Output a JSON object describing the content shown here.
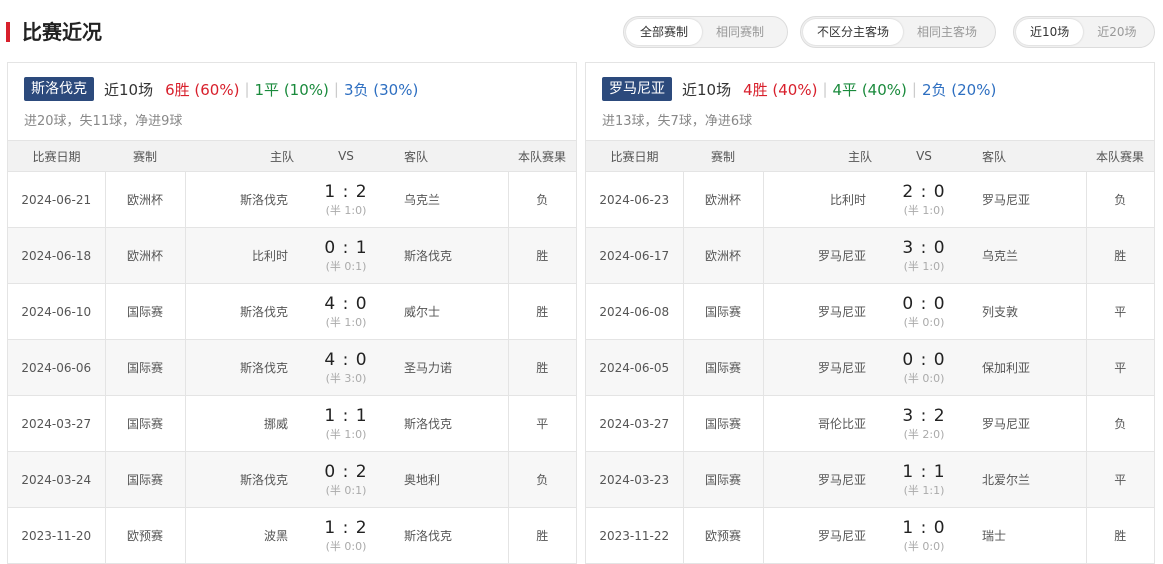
{
  "header": {
    "title": "比赛近况",
    "filter_competition": [
      "全部赛制",
      "相同赛制"
    ],
    "filter_venue": [
      "不区分主客场",
      "相同主客场"
    ],
    "filter_count": [
      "近10场",
      "近20场"
    ]
  },
  "columns": [
    "比赛日期",
    "赛制",
    "主队",
    "VS",
    "客队",
    "本队赛果"
  ],
  "teams": [
    {
      "name": "斯洛伐克",
      "recent_label": "近10场",
      "wins": "6胜 (60%)",
      "draws": "1平 (10%)",
      "losses": "3负 (30%)",
      "goals": "进20球，失11球，净进9球",
      "matches": [
        {
          "date": "2024-06-21",
          "comp": "欧洲杯",
          "home": "斯洛伐克",
          "score": "1 : 2",
          "half": "(半 1:0)",
          "away": "乌克兰",
          "result": "负",
          "type": "l",
          "team_home": true
        },
        {
          "date": "2024-06-18",
          "comp": "欧洲杯",
          "home": "比利时",
          "score": "0 : 1",
          "half": "(半 0:1)",
          "away": "斯洛伐克",
          "result": "胜",
          "type": "w",
          "team_home": false
        },
        {
          "date": "2024-06-10",
          "comp": "国际赛",
          "home": "斯洛伐克",
          "score": "4 : 0",
          "half": "(半 1:0)",
          "away": "威尔士",
          "result": "胜",
          "type": "w",
          "team_home": true
        },
        {
          "date": "2024-06-06",
          "comp": "国际赛",
          "home": "斯洛伐克",
          "score": "4 : 0",
          "half": "(半 3:0)",
          "away": "圣马力诺",
          "result": "胜",
          "type": "w",
          "team_home": true
        },
        {
          "date": "2024-03-27",
          "comp": "国际赛",
          "home": "挪威",
          "score": "1 : 1",
          "half": "(半 1:0)",
          "away": "斯洛伐克",
          "result": "平",
          "type": "d",
          "team_home": false
        },
        {
          "date": "2024-03-24",
          "comp": "国际赛",
          "home": "斯洛伐克",
          "score": "0 : 2",
          "half": "(半 0:1)",
          "away": "奥地利",
          "result": "负",
          "type": "l",
          "team_home": true
        },
        {
          "date": "2023-11-20",
          "comp": "欧预赛",
          "home": "波黑",
          "score": "1 : 2",
          "half": "(半 0:0)",
          "away": "斯洛伐克",
          "result": "胜",
          "type": "w",
          "team_home": false
        }
      ]
    },
    {
      "name": "罗马尼亚",
      "recent_label": "近10场",
      "wins": "4胜 (40%)",
      "draws": "4平 (40%)",
      "losses": "2负 (20%)",
      "goals": "进13球，失7球，净进6球",
      "matches": [
        {
          "date": "2024-06-23",
          "comp": "欧洲杯",
          "home": "比利时",
          "score": "2 : 0",
          "half": "(半 1:0)",
          "away": "罗马尼亚",
          "result": "负",
          "type": "l",
          "team_home": false
        },
        {
          "date": "2024-06-17",
          "comp": "欧洲杯",
          "home": "罗马尼亚",
          "score": "3 : 0",
          "half": "(半 1:0)",
          "away": "乌克兰",
          "result": "胜",
          "type": "w",
          "team_home": true
        },
        {
          "date": "2024-06-08",
          "comp": "国际赛",
          "home": "罗马尼亚",
          "score": "0 : 0",
          "half": "(半 0:0)",
          "away": "列支敦",
          "result": "平",
          "type": "d",
          "team_home": true
        },
        {
          "date": "2024-06-05",
          "comp": "国际赛",
          "home": "罗马尼亚",
          "score": "0 : 0",
          "half": "(半 0:0)",
          "away": "保加利亚",
          "result": "平",
          "type": "d",
          "team_home": true
        },
        {
          "date": "2024-03-27",
          "comp": "国际赛",
          "home": "哥伦比亚",
          "score": "3 : 2",
          "half": "(半 2:0)",
          "away": "罗马尼亚",
          "result": "负",
          "type": "l",
          "team_home": false
        },
        {
          "date": "2024-03-23",
          "comp": "国际赛",
          "home": "罗马尼亚",
          "score": "1 : 1",
          "half": "(半 1:1)",
          "away": "北爱尔兰",
          "result": "平",
          "type": "d",
          "team_home": true
        },
        {
          "date": "2023-11-22",
          "comp": "欧预赛",
          "home": "罗马尼亚",
          "score": "1 : 0",
          "half": "(半 0:0)",
          "away": "瑞士",
          "result": "胜",
          "type": "w",
          "team_home": true
        }
      ]
    }
  ],
  "colors": {
    "title_mark": "#d8202c",
    "badge": "#2c4a7c",
    "win": "#d8202c",
    "draw": "#1a8a3c",
    "loss": "#2e6fc1"
  }
}
